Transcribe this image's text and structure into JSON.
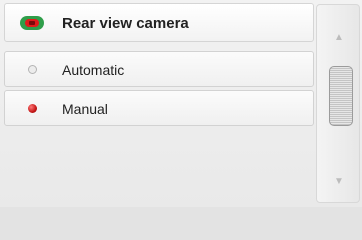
{
  "header": {
    "icon": "rear-camera-icon",
    "title": "Rear view camera"
  },
  "options": [
    {
      "label": "Automatic",
      "selected": false
    },
    {
      "label": "Manual",
      "selected": true
    }
  ],
  "scrollbar": {
    "up_icon": "arrow-up-icon",
    "down_icon": "arrow-down-icon"
  },
  "colors": {
    "selected_radio": "#c51616",
    "camera_icon_outer": "#2f9e4a",
    "camera_icon_inner": "#e01b1b"
  }
}
